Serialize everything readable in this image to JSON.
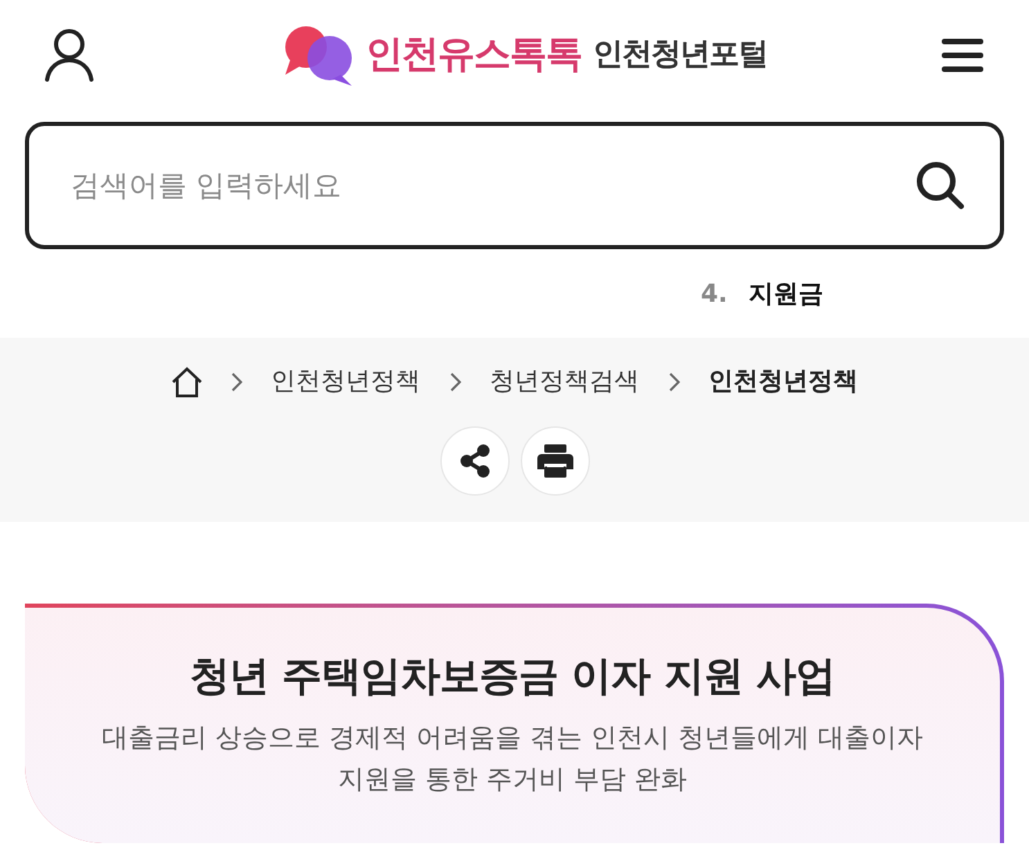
{
  "header": {
    "logo": {
      "brand": "인천유스톡톡",
      "portal": "인천청년포털"
    }
  },
  "search": {
    "placeholder": "검색어를 입력하세요"
  },
  "popular_keyword": {
    "rank": "4.",
    "keyword": "지원금"
  },
  "breadcrumb": [
    {
      "label": "인천청년정책",
      "current": false
    },
    {
      "label": "청년정책검색",
      "current": false
    },
    {
      "label": "인천청년정책",
      "current": true
    }
  ],
  "actions": [
    {
      "kind": "share"
    },
    {
      "kind": "print"
    }
  ],
  "policy_card": {
    "title": "청년 주택임차보증금 이자 지원 사업",
    "description": "대출금리 상승으로 경제적 어려움을 겪는 인천시 청년들에게 대출이자 지원을 통한 주거비 부담 완화"
  }
}
